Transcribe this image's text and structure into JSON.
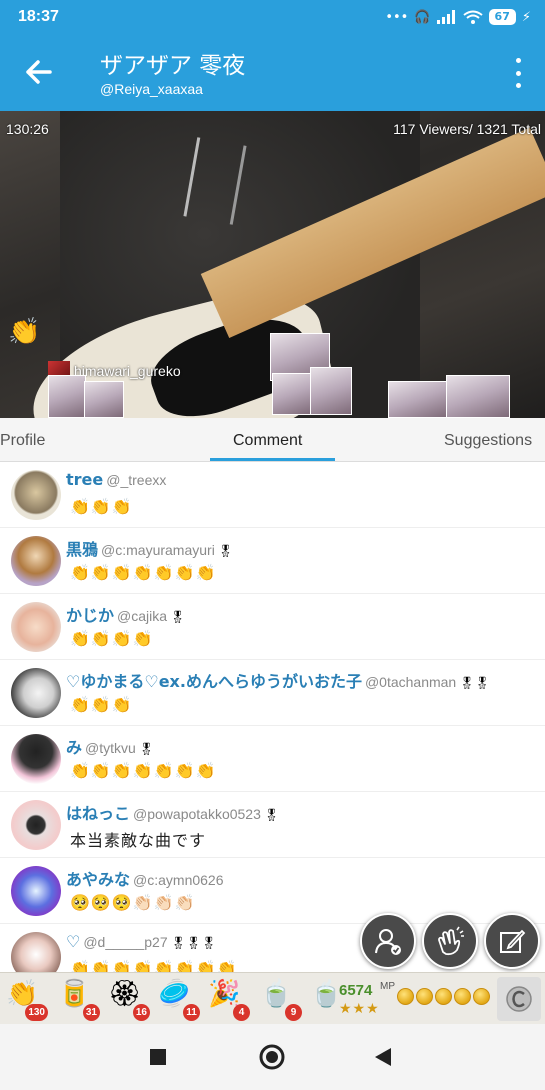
{
  "status_bar": {
    "time": "18:37",
    "battery": "67"
  },
  "header": {
    "title": "ザアザア 零夜",
    "handle": "@Reiya_xaaxaa"
  },
  "video": {
    "elapsed": "130:26",
    "viewers": "117 Viewers/ 1321 Total",
    "gift_sender": "himawari_gureko"
  },
  "tabs": [
    {
      "label": "Profile"
    },
    {
      "label": "Comment"
    },
    {
      "label": "Suggestions"
    }
  ],
  "comments": [
    {
      "name": "tree",
      "handle": "@_treexx",
      "badge": "",
      "text": "👏👏👏"
    },
    {
      "name": "黒鴉",
      "handle": "@c:mayuramayuri",
      "badge": "🎖",
      "text": "👏👏👏👏👏👏👏"
    },
    {
      "name": "かじか",
      "handle": "@cajika",
      "badge": "🎖",
      "text": "👏👏👏👏"
    },
    {
      "name": "♡ゆかまる♡ex.めんへらゆうがいおた子",
      "handle": "@0tachanman",
      "badge": "🎖🎖",
      "text": "👏👏👏"
    },
    {
      "name": "み",
      "handle": "@tytkvu",
      "badge": "🎖",
      "text": "👏👏👏👏👏👏👏"
    },
    {
      "name": "はねっこ",
      "handle": "@powapotakko0523",
      "badge": "🎖",
      "text": "本当素敵な曲です"
    },
    {
      "name": "あやみな",
      "handle": "@c:aymn0626",
      "badge": "",
      "text": "🥺🥺🥺👏🏻👏🏻👏🏻"
    },
    {
      "name": "♡",
      "handle": "@d_____p27",
      "badge": "🎖🎖🎖",
      "text": "👏👏👏👏👏👏👏👏"
    }
  ],
  "gifts": [
    {
      "icon": "clap-gift-icon",
      "glyph": "👏",
      "count": "130"
    },
    {
      "icon": "drink-can-gift-icon",
      "glyph": "🥫",
      "count": "31"
    },
    {
      "icon": "wreath-gift-icon",
      "glyph": "🏵",
      "count": "16"
    },
    {
      "icon": "cymbal-gift-icon",
      "glyph": "🥏",
      "count": "11"
    },
    {
      "icon": "party-popper-gift-icon",
      "glyph": "🎉",
      "count": "4"
    },
    {
      "icon": "tea-can-gift-icon",
      "glyph": "🍵",
      "count": "9"
    },
    {
      "icon": "tea-can-50-gift-icon",
      "glyph": "🍵",
      "count": ""
    }
  ],
  "wallet": {
    "mp": "6574",
    "mp_label": "MP",
    "stars": "★★★"
  },
  "colors": {
    "brand": "#2a9fdc",
    "name": "#2a7fb5",
    "badge": "#d9342b"
  }
}
